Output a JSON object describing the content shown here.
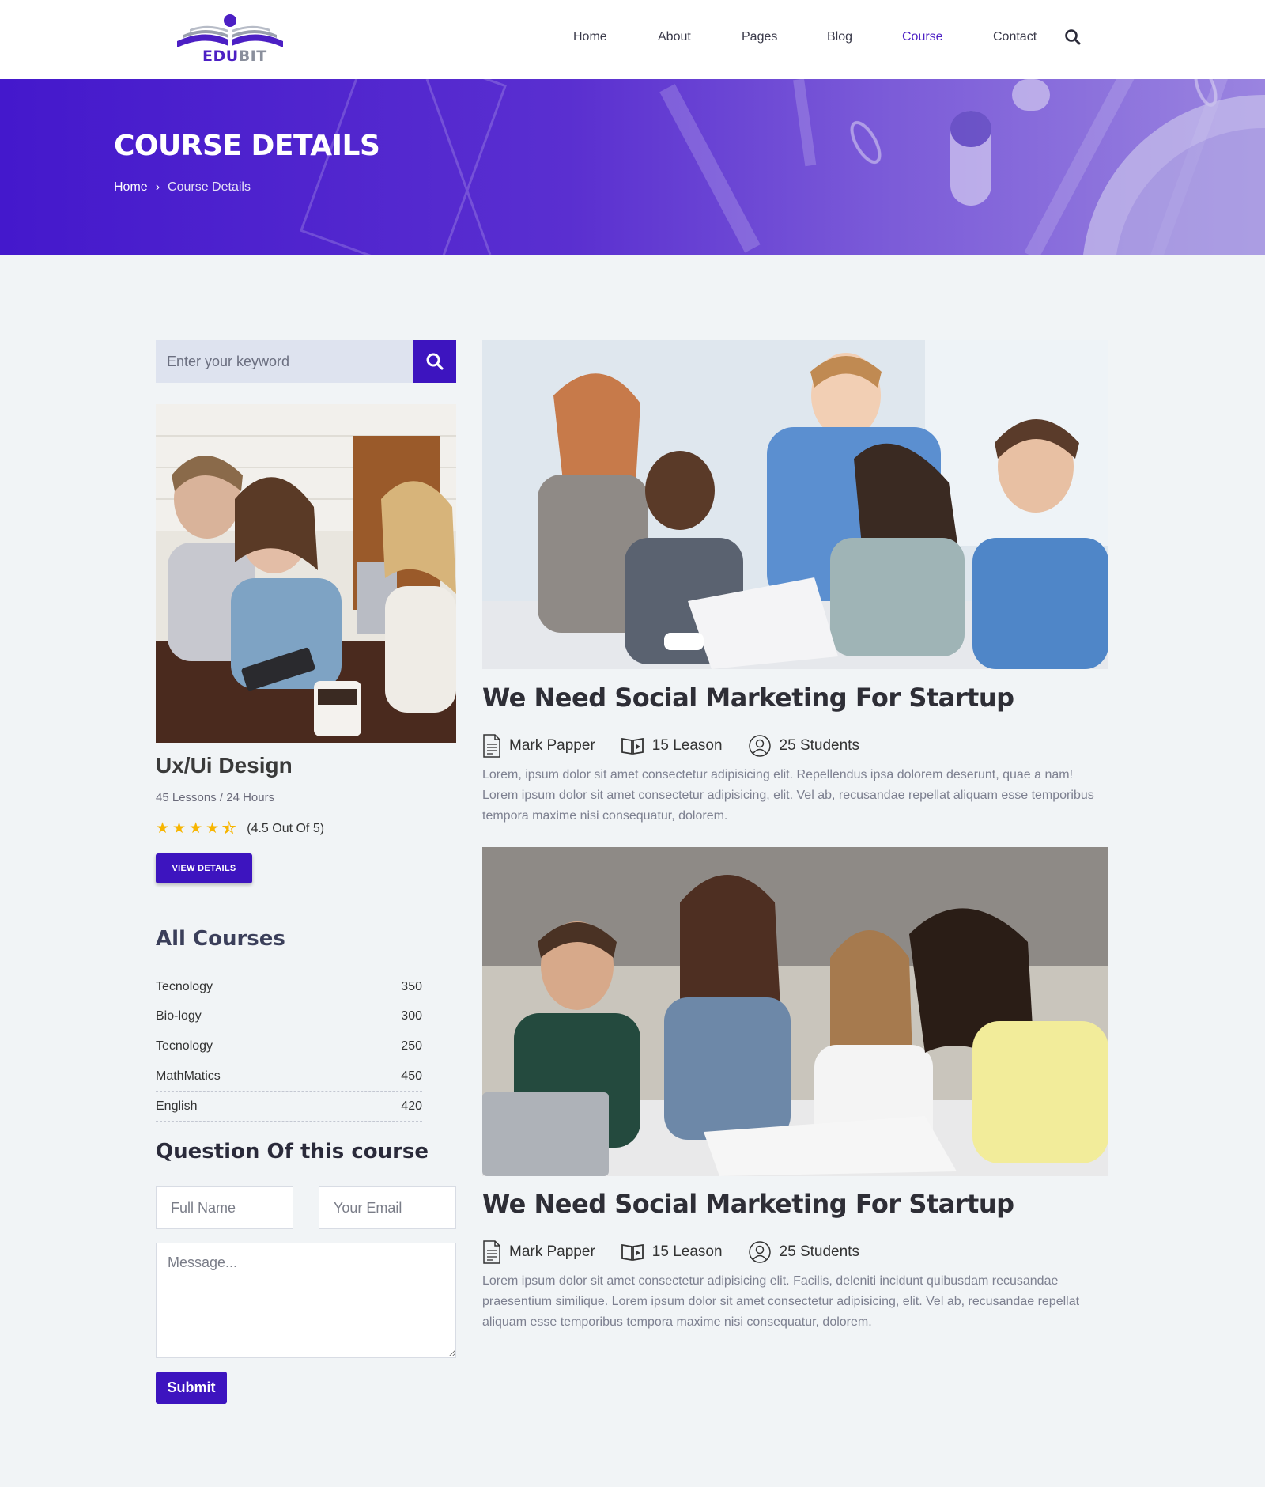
{
  "brand": {
    "name_part1": "EDU",
    "name_part2": "BIT",
    "colors": {
      "primary": "#3d14bf",
      "accent": "#4c1fc4"
    }
  },
  "nav": {
    "items": [
      {
        "label": "Home",
        "active": false
      },
      {
        "label": "About",
        "active": false
      },
      {
        "label": "Pages",
        "active": false
      },
      {
        "label": "Blog",
        "active": false
      },
      {
        "label": "Course",
        "active": true
      },
      {
        "label": "Contact",
        "active": false
      }
    ],
    "search_icon": "search-icon"
  },
  "hero": {
    "title": "COURSE DETAILS",
    "breadcrumb": {
      "home": "Home",
      "current": "Course Details"
    }
  },
  "sidebar": {
    "search": {
      "placeholder": "Enter your keyword"
    },
    "course_card": {
      "title": "Ux/Ui Design",
      "meta": "45 Lessons / 24 Hours",
      "rating_value": 4.5,
      "rating_text": "(4.5 Out Of 5)",
      "button": "VIEW DETAILS"
    },
    "all_courses": {
      "title": "All Courses",
      "items": [
        {
          "name": "Tecnology",
          "count": "350"
        },
        {
          "name": "Bio-logy",
          "count": "300"
        },
        {
          "name": "Tecnology",
          "count": "250"
        },
        {
          "name": "MathMatics",
          "count": "450"
        },
        {
          "name": "English",
          "count": "420"
        }
      ]
    },
    "question_form": {
      "title": "Question Of this course",
      "full_name_placeholder": "Full Name",
      "email_placeholder": "Your Email",
      "message_placeholder": "Message...",
      "submit": "Submit"
    }
  },
  "posts": [
    {
      "title": "We Need Social Marketing For Startup",
      "author": "Mark Papper",
      "lessons": "15 Leason",
      "students": "25 Students",
      "description": "Lorem, ipsum dolor sit amet consectetur adipisicing elit. Repellendus ipsa dolorem deserunt, quae a nam! Lorem ipsum dolor sit amet consectetur adipisicing, elit. Vel ab, recusandae repellat aliquam esse temporibus tempora maxime nisi consequatur, dolorem."
    },
    {
      "title": "We Need Social Marketing For Startup",
      "author": "Mark Papper",
      "lessons": "15 Leason",
      "students": "25 Students",
      "description": "Lorem ipsum dolor sit amet consectetur adipisicing elit. Facilis, deleniti incidunt quibusdam recusandae praesentium similique. Lorem ipsum dolor sit amet consectetur adipisicing, elit. Vel ab, recusandae repellat aliquam esse temporibus tempora maxime nisi consequatur, dolorem."
    }
  ]
}
